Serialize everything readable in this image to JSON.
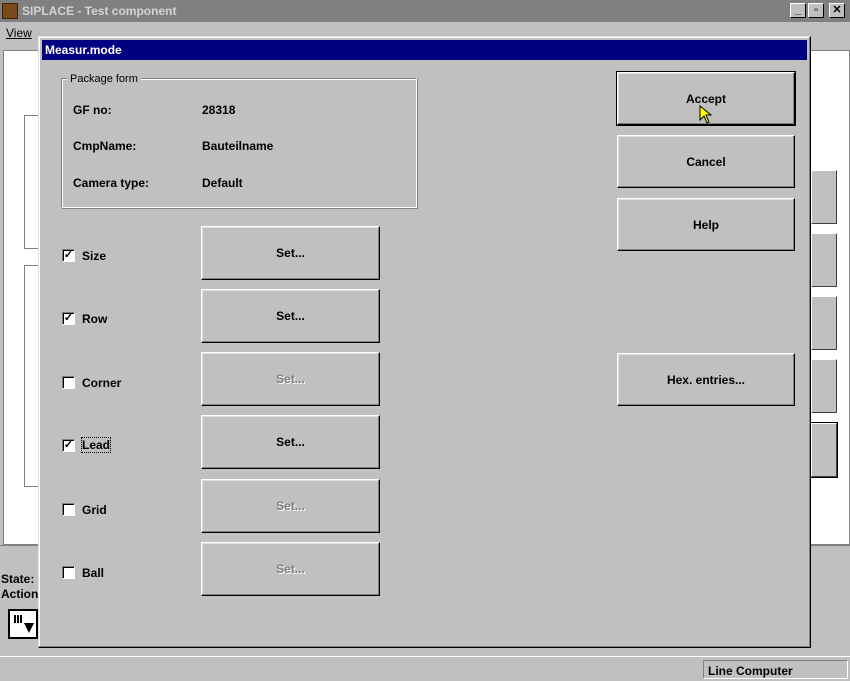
{
  "app": {
    "title": "SIPLACE - Test component",
    "minimize": "_",
    "maximize": "▫",
    "close": "✕"
  },
  "menu": {
    "view": "View"
  },
  "background": {
    "state_label": "State:",
    "action_label": "Action"
  },
  "statusbar": {
    "line_computer": "Line Computer"
  },
  "dialog": {
    "title": "Measur.mode",
    "package_form": {
      "legend": "Package form",
      "rows": [
        {
          "label": "GF no:",
          "value": "28318"
        },
        {
          "label": "CmpName:",
          "value": "Bauteilname"
        },
        {
          "label": "Camera type:",
          "value": "Default"
        }
      ]
    },
    "options": [
      {
        "label": "Size",
        "checked": true,
        "set_label": "Set...",
        "set_enabled": true
      },
      {
        "label": "Row",
        "checked": true,
        "set_label": "Set...",
        "set_enabled": true
      },
      {
        "label": "Corner",
        "checked": false,
        "set_label": "Set...",
        "set_enabled": false
      },
      {
        "label": "Lead",
        "checked": true,
        "set_label": "Set...",
        "set_enabled": true
      },
      {
        "label": "Grid",
        "checked": false,
        "set_label": "Set...",
        "set_enabled": false
      },
      {
        "label": "Ball",
        "checked": false,
        "set_label": "Set...",
        "set_enabled": false
      }
    ],
    "buttons": {
      "accept": "Accept",
      "cancel": "Cancel",
      "help": "Help",
      "hex": "Hex. entries..."
    }
  },
  "colors": {
    "titlebar_inactive": "#808080",
    "titlebar_active": "#000080",
    "face": "#c0c0c0"
  }
}
